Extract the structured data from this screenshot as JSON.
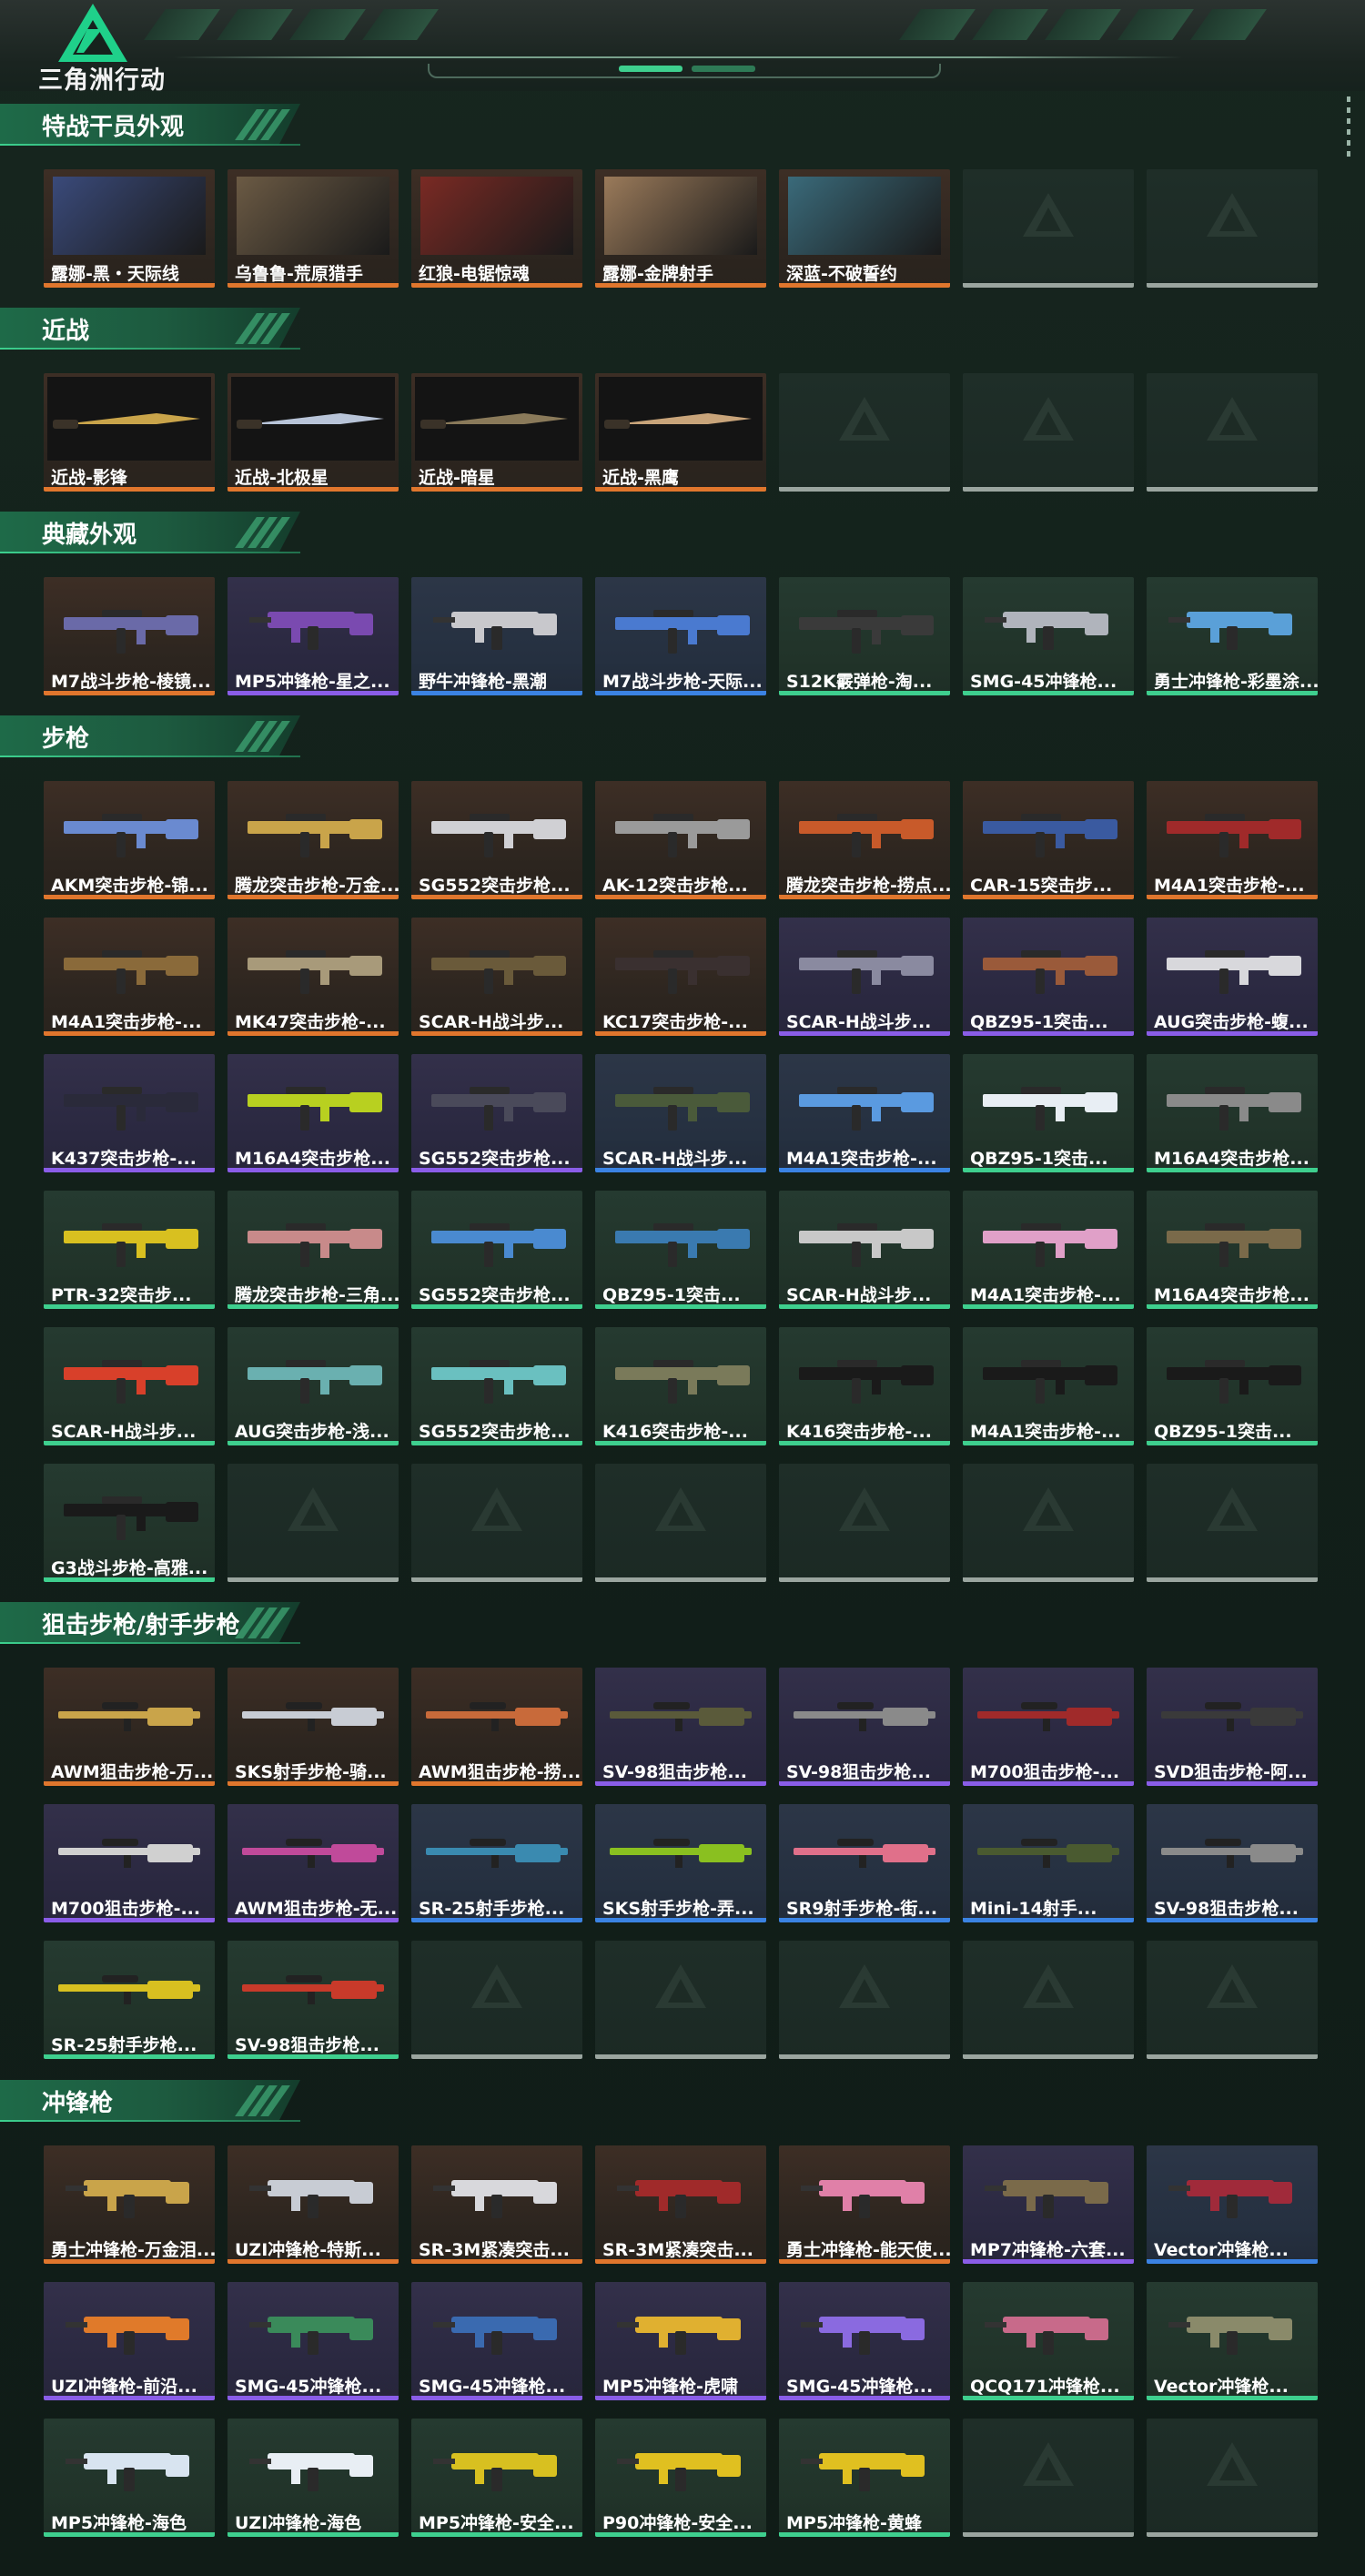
{
  "brand": {
    "logo_text": "三角洲行动"
  },
  "colors": {
    "orange": "#e0762d",
    "purple": "#8a5de8",
    "blue": "#3b83e3",
    "green": "#3ecf8e",
    "empty": "#9aa59f"
  },
  "sections": [
    {
      "title": "特战干员外观",
      "rows": [
        [
          {
            "label": "露娜-黑・天际线",
            "rarity": "orange",
            "kind": "portrait",
            "art": "#3a4a7a"
          },
          {
            "label": "乌鲁鲁-荒原猎手",
            "rarity": "orange",
            "kind": "portrait",
            "art": "#6b5a44"
          },
          {
            "label": "红狼-电锯惊魂",
            "rarity": "orange",
            "kind": "portrait",
            "art": "#7a2a24"
          },
          {
            "label": "露娜-金牌射手",
            "rarity": "orange",
            "kind": "portrait",
            "art": "#9a7a5a"
          },
          {
            "label": "深蓝-不破誓约",
            "rarity": "orange",
            "kind": "portrait",
            "art": "#3a6a7a"
          },
          {
            "label": "",
            "rarity": "empty",
            "kind": "empty"
          },
          {
            "label": "",
            "rarity": "empty",
            "kind": "empty"
          }
        ]
      ]
    },
    {
      "title": "近战",
      "rows": [
        [
          {
            "label": "近战-影锋",
            "rarity": "orange",
            "kind": "knife",
            "art": "#c9a44a"
          },
          {
            "label": "近战-北极星",
            "rarity": "orange",
            "kind": "knife",
            "art": "#b8c4d8"
          },
          {
            "label": "近战-暗星",
            "rarity": "orange",
            "kind": "knife",
            "art": "#8a7a5a"
          },
          {
            "label": "近战-黑鹰",
            "rarity": "orange",
            "kind": "knife",
            "art": "#c8a47a"
          },
          {
            "label": "",
            "rarity": "empty",
            "kind": "empty"
          },
          {
            "label": "",
            "rarity": "empty",
            "kind": "empty"
          },
          {
            "label": "",
            "rarity": "empty",
            "kind": "empty"
          }
        ]
      ]
    },
    {
      "title": "典藏外观",
      "rows": [
        [
          {
            "label": "M7战斗步枪-棱镜...",
            "rarity": "orange",
            "kind": "rifle",
            "art": "#6a6aa8"
          },
          {
            "label": "MP5冲锋枪-星之...",
            "rarity": "purple",
            "kind": "smg",
            "art": "#7a4ab0"
          },
          {
            "label": "野牛冲锋枪-黑潮",
            "rarity": "blue",
            "kind": "smg",
            "art": "#c8c8cc"
          },
          {
            "label": "M7战斗步枪-天际...",
            "rarity": "blue",
            "kind": "rifle",
            "art": "#4a7ad0"
          },
          {
            "label": "S12K霰弹枪-淘...",
            "rarity": "green",
            "kind": "rifle",
            "art": "#3a3a3a"
          },
          {
            "label": "SMG-45冲锋枪...",
            "rarity": "green",
            "kind": "smg",
            "art": "#b0b4bc"
          },
          {
            "label": "勇士冲锋枪-彩墨涂...",
            "rarity": "green",
            "kind": "smg",
            "art": "#5aa0d8"
          }
        ]
      ]
    },
    {
      "title": "步枪",
      "rows": [
        [
          {
            "label": "AKM突击步枪-锦...",
            "rarity": "orange",
            "kind": "rifle",
            "art": "#6a8ad0"
          },
          {
            "label": "腾龙突击步枪-万金...",
            "rarity": "orange",
            "kind": "rifle",
            "art": "#c9a44a"
          },
          {
            "label": "SG552突击步枪...",
            "rarity": "orange",
            "kind": "rifle",
            "art": "#d0d0d4"
          },
          {
            "label": "AK-12突击步枪...",
            "rarity": "orange",
            "kind": "rifle",
            "art": "#9a9a9a"
          },
          {
            "label": "腾龙突击步枪-捞点...",
            "rarity": "orange",
            "kind": "rifle",
            "art": "#c85a2a"
          },
          {
            "label": "CAR-15突击步...",
            "rarity": "orange",
            "kind": "rifle",
            "art": "#3a5aa0"
          },
          {
            "label": "M4A1突击步枪-...",
            "rarity": "orange",
            "kind": "rifle",
            "art": "#a02a2a"
          }
        ],
        [
          {
            "label": "M4A1突击步枪-...",
            "rarity": "orange",
            "kind": "rifle",
            "art": "#8a6a3a"
          },
          {
            "label": "MK47突击步枪-...",
            "rarity": "orange",
            "kind": "rifle",
            "art": "#a89a7a"
          },
          {
            "label": "SCAR-H战斗步...",
            "rarity": "orange",
            "kind": "rifle",
            "art": "#6a5a3a"
          },
          {
            "label": "KC17突击步枪-...",
            "rarity": "orange",
            "kind": "rifle",
            "art": "#3a3030"
          },
          {
            "label": "SCAR-H战斗步...",
            "rarity": "purple",
            "kind": "rifle",
            "art": "#8a8aa0"
          },
          {
            "label": "QBZ95-1突击...",
            "rarity": "purple",
            "kind": "rifle",
            "art": "#9a5a3a"
          },
          {
            "label": "AUG突击步枪-蝮...",
            "rarity": "purple",
            "kind": "rifle",
            "art": "#d8d8dc"
          }
        ],
        [
          {
            "label": "K437突击步枪-...",
            "rarity": "purple",
            "kind": "rifle",
            "art": "#2a2a3a"
          },
          {
            "label": "M16A4突击步枪...",
            "rarity": "purple",
            "kind": "rifle",
            "art": "#b8d020"
          },
          {
            "label": "SG552突击步枪...",
            "rarity": "purple",
            "kind": "rifle",
            "art": "#4a4a5a"
          },
          {
            "label": "SCAR-H战斗步...",
            "rarity": "blue",
            "kind": "rifle",
            "art": "#4a5a3a"
          },
          {
            "label": "M4A1突击步枪-...",
            "rarity": "blue",
            "kind": "rifle",
            "art": "#5a9ae0"
          },
          {
            "label": "QBZ95-1突击...",
            "rarity": "green",
            "kind": "rifle",
            "art": "#e8eef4"
          },
          {
            "label": "M16A4突击步枪...",
            "rarity": "green",
            "kind": "rifle",
            "art": "#8a8a8a"
          }
        ],
        [
          {
            "label": "PTR-32突击步...",
            "rarity": "green",
            "kind": "rifle",
            "art": "#d8c020"
          },
          {
            "label": "腾龙突击步枪-三角...",
            "rarity": "green",
            "kind": "rifle",
            "art": "#c88a8a"
          },
          {
            "label": "SG552突击步枪...",
            "rarity": "green",
            "kind": "rifle",
            "art": "#4a8ad0"
          },
          {
            "label": "QBZ95-1突击...",
            "rarity": "green",
            "kind": "rifle",
            "art": "#3a7ab0"
          },
          {
            "label": "SCAR-H战斗步...",
            "rarity": "green",
            "kind": "rifle",
            "art": "#c8c8c8"
          },
          {
            "label": "M4A1突击步枪-...",
            "rarity": "green",
            "kind": "rifle",
            "art": "#e0a0c8"
          },
          {
            "label": "M16A4突击步枪...",
            "rarity": "green",
            "kind": "rifle",
            "art": "#7a6a4a"
          }
        ],
        [
          {
            "label": "SCAR-H战斗步...",
            "rarity": "green",
            "kind": "rifle",
            "art": "#d8402a"
          },
          {
            "label": "AUG突击步枪-浅...",
            "rarity": "green",
            "kind": "rifle",
            "art": "#6ab0b0"
          },
          {
            "label": "SG552突击步枪...",
            "rarity": "green",
            "kind": "rifle",
            "art": "#6ac0c0"
          },
          {
            "label": "K416突击步枪-...",
            "rarity": "green",
            "kind": "rifle",
            "art": "#7a7a5a"
          },
          {
            "label": "K416突击步枪-...",
            "rarity": "green",
            "kind": "rifle",
            "art": "#1a1a1a"
          },
          {
            "label": "M4A1突击步枪-...",
            "rarity": "green",
            "kind": "rifle",
            "art": "#1a1a1a"
          },
          {
            "label": "QBZ95-1突击...",
            "rarity": "green",
            "kind": "rifle",
            "art": "#1a1a1a"
          }
        ],
        [
          {
            "label": "G3战斗步枪-高雅...",
            "rarity": "green",
            "kind": "rifle",
            "art": "#1a1a1a"
          },
          {
            "label": "",
            "rarity": "empty",
            "kind": "empty"
          },
          {
            "label": "",
            "rarity": "empty",
            "kind": "empty"
          },
          {
            "label": "",
            "rarity": "empty",
            "kind": "empty"
          },
          {
            "label": "",
            "rarity": "empty",
            "kind": "empty"
          },
          {
            "label": "",
            "rarity": "empty",
            "kind": "empty"
          },
          {
            "label": "",
            "rarity": "empty",
            "kind": "empty"
          }
        ]
      ]
    },
    {
      "title": "狙击步枪/射手步枪",
      "rows": [
        [
          {
            "label": "AWM狙击步枪-万...",
            "rarity": "orange",
            "kind": "sniper",
            "art": "#c9a44a"
          },
          {
            "label": "SKS射手步枪-骑...",
            "rarity": "orange",
            "kind": "sniper",
            "art": "#c8ccd4"
          },
          {
            "label": "AWM狙击步枪-捞...",
            "rarity": "orange",
            "kind": "sniper",
            "art": "#c86a3a"
          },
          {
            "label": "SV-98狙击步枪...",
            "rarity": "purple",
            "kind": "sniper",
            "art": "#5a5a3a"
          },
          {
            "label": "SV-98狙击步枪...",
            "rarity": "purple",
            "kind": "sniper",
            "art": "#8a8a8a"
          },
          {
            "label": "M700狙击步枪-...",
            "rarity": "purple",
            "kind": "sniper",
            "art": "#a02a2a"
          },
          {
            "label": "SVD狙击步枪-阿...",
            "rarity": "purple",
            "kind": "sniper",
            "art": "#3a3a3a"
          }
        ],
        [
          {
            "label": "M700狙击步枪-...",
            "rarity": "purple",
            "kind": "sniper",
            "art": "#d0d0d0"
          },
          {
            "label": "AWM狙击步枪-无...",
            "rarity": "purple",
            "kind": "sniper",
            "art": "#c04a9a"
          },
          {
            "label": "SR-25射手步枪...",
            "rarity": "blue",
            "kind": "sniper",
            "art": "#3a8ab0"
          },
          {
            "label": "SKS射手步枪-弄...",
            "rarity": "blue",
            "kind": "sniper",
            "art": "#8ac020"
          },
          {
            "label": "SR9射手步枪-街...",
            "rarity": "blue",
            "kind": "sniper",
            "art": "#e0708a"
          },
          {
            "label": "Mini-14射手...",
            "rarity": "blue",
            "kind": "sniper",
            "art": "#4a5a30"
          },
          {
            "label": "SV-98狙击步枪...",
            "rarity": "blue",
            "kind": "sniper",
            "art": "#8a8a8a"
          }
        ],
        [
          {
            "label": "SR-25射手步枪...",
            "rarity": "green",
            "kind": "sniper",
            "art": "#d8c020"
          },
          {
            "label": "SV-98狙击步枪...",
            "rarity": "green",
            "kind": "sniper",
            "art": "#c83a2a"
          },
          {
            "label": "",
            "rarity": "empty",
            "kind": "empty"
          },
          {
            "label": "",
            "rarity": "empty",
            "kind": "empty"
          },
          {
            "label": "",
            "rarity": "empty",
            "kind": "empty"
          },
          {
            "label": "",
            "rarity": "empty",
            "kind": "empty"
          },
          {
            "label": "",
            "rarity": "empty",
            "kind": "empty"
          }
        ]
      ]
    },
    {
      "title": "冲锋枪",
      "rows": [
        [
          {
            "label": "勇士冲锋枪-万金泪...",
            "rarity": "orange",
            "kind": "smg",
            "art": "#c9a44a"
          },
          {
            "label": "UZI冲锋枪-特斯...",
            "rarity": "orange",
            "kind": "smg",
            "art": "#c8ccd4"
          },
          {
            "label": "SR-3M紧凑突击...",
            "rarity": "orange",
            "kind": "smg",
            "art": "#d8d8dc"
          },
          {
            "label": "SR-3M紧凑突击...",
            "rarity": "orange",
            "kind": "smg",
            "art": "#a02a2a"
          },
          {
            "label": "勇士冲锋枪-能天使...",
            "rarity": "orange",
            "kind": "smg",
            "art": "#e080a8"
          },
          {
            "label": "MP7冲锋枪-六套...",
            "rarity": "purple",
            "kind": "smg",
            "art": "#7a6a4a"
          },
          {
            "label": "Vector冲锋枪...",
            "rarity": "blue",
            "kind": "smg",
            "art": "#a02a3a"
          }
        ],
        [
          {
            "label": "UZI冲锋枪-前沿...",
            "rarity": "purple",
            "kind": "smg",
            "art": "#e07a2a"
          },
          {
            "label": "SMG-45冲锋枪...",
            "rarity": "purple",
            "kind": "smg",
            "art": "#3a8a5a"
          },
          {
            "label": "SMG-45冲锋枪...",
            "rarity": "purple",
            "kind": "smg",
            "art": "#3a6ab0"
          },
          {
            "label": "MP5冲锋枪-虎啸",
            "rarity": "purple",
            "kind": "smg",
            "art": "#e0b030"
          },
          {
            "label": "SMG-45冲锋枪...",
            "rarity": "purple",
            "kind": "smg",
            "art": "#8a6ae0"
          },
          {
            "label": "QCQ171冲锋枪...",
            "rarity": "green",
            "kind": "smg",
            "art": "#c86a8a"
          },
          {
            "label": "Vector冲锋枪...",
            "rarity": "green",
            "kind": "smg",
            "art": "#8a8a6a"
          }
        ],
        [
          {
            "label": "MP5冲锋枪-海色",
            "rarity": "green",
            "kind": "smg",
            "art": "#d8e4f0"
          },
          {
            "label": "UZI冲锋枪-海色",
            "rarity": "green",
            "kind": "smg",
            "art": "#e8eef4"
          },
          {
            "label": "MP5冲锋枪-安全...",
            "rarity": "green",
            "kind": "smg",
            "art": "#d8c020"
          },
          {
            "label": "P90冲锋枪-安全...",
            "rarity": "green",
            "kind": "smg",
            "art": "#e0c020"
          },
          {
            "label": "MP5冲锋枪-黄蜂",
            "rarity": "green",
            "kind": "smg",
            "art": "#e0c020"
          },
          {
            "label": "",
            "rarity": "empty",
            "kind": "empty"
          },
          {
            "label": "",
            "rarity": "empty",
            "kind": "empty"
          }
        ]
      ]
    }
  ]
}
